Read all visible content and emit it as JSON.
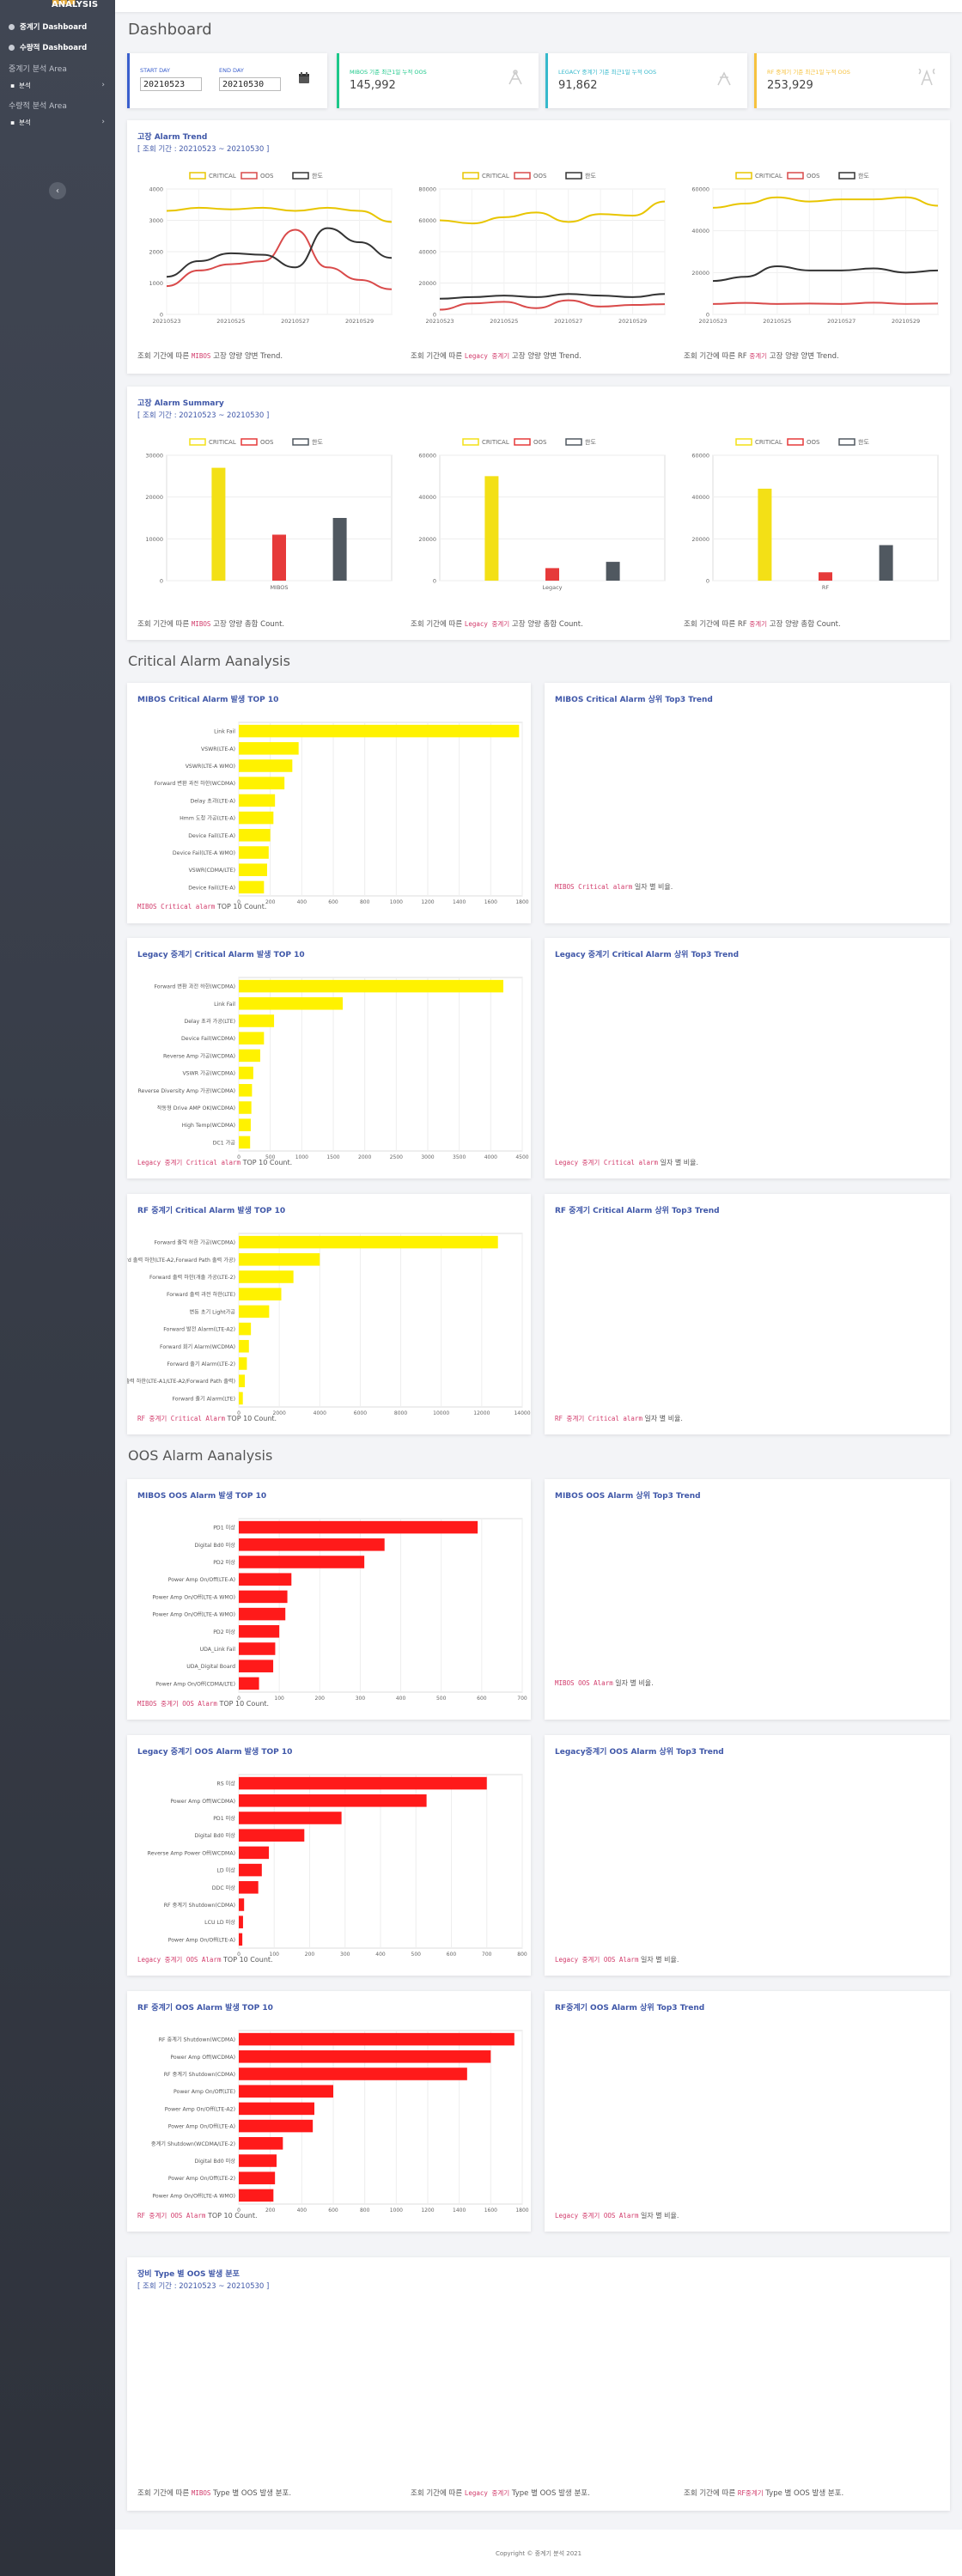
{
  "sidebar": {
    "brand_suffix": "ANALYSIS",
    "items": [
      {
        "label": "중계기 Dashboard"
      },
      {
        "label": "수량적 Dashboard"
      }
    ],
    "sections": [
      {
        "heading": "중계기 분석 Area",
        "sub": "분석"
      },
      {
        "heading": "수량적 분석 Area",
        "sub": "분석"
      }
    ],
    "toggle_icon": "chevron-left-icon"
  },
  "page": {
    "title": "Dashboard"
  },
  "date_range": {
    "start_label": "START DAY",
    "start_value": "20210523",
    "end_label": "END DAY",
    "end_value": "20210530",
    "icon": "calendar-icon"
  },
  "stats": [
    {
      "label": "MIBOS 기준 최근1일 누적 OOS",
      "value": "145,992",
      "color": "#1cc88a",
      "icon": "satellite-icon"
    },
    {
      "label": "LEGACY 중계기 기준 최근1일 누적 OOS",
      "value": "91,862",
      "color": "#36b9cc",
      "icon": "antenna-icon"
    },
    {
      "label": "RF 중계기 기준 최근1일 누적 OOS",
      "value": "253,929",
      "color": "#f6c23e",
      "icon": "tower-icon"
    }
  ],
  "trend": {
    "title": "고장 Alarm Trend",
    "subtitle": "[ 조회 기간 : 20210523 ~ 20210530 ]",
    "legend": [
      "CRITICAL",
      "OOS",
      "한도"
    ],
    "captions": [
      {
        "pre": "조회 기간에 따른 ",
        "code": "MIBOS",
        "post": " 고장 양량 양변 Trend."
      },
      {
        "pre": "조회 기간에 따른 ",
        "code": "Legacy 중계기",
        "post": " 고장 양량 양변 Trend."
      },
      {
        "pre": "조회 기간에 따른 RF ",
        "code": "중계기",
        "post": " 고장 양량 양변 Trend."
      }
    ]
  },
  "summary": {
    "title": "고장 Alarm Summary",
    "subtitle": "[ 조회 기간 : 20210523 ~ 20210530 ]",
    "legend": [
      "CRITICAL",
      "OOS",
      "한도"
    ],
    "captions": [
      {
        "pre": "조회 기간에 따른 ",
        "code": "MIBOS",
        "post": " 고장 양량 총합 Count."
      },
      {
        "pre": "조회 기간에 따른 ",
        "code": "Legacy 중계기",
        "post": " 고장 양량 총합 Count."
      },
      {
        "pre": "조회 기간에 따른 RF ",
        "code": "중계기",
        "post": " 고장 양량 총합 Count."
      }
    ]
  },
  "critical_section": {
    "title": "Critical Alarm Aanalysis"
  },
  "oos_section": {
    "title": "OOS Alarm Aanalysis"
  },
  "panels": {
    "mibos_crit": {
      "title": "MIBOS Critical Alarm 발생 TOP 10",
      "caption_code": "MIBOS Critical alarm",
      "caption_post": " TOP 10 Count."
    },
    "mibos_crit_top3": {
      "title": "MIBOS Critical Alarm 상위 Top3 Trend",
      "caption_code": "MIBOS Critical alarm",
      "caption_post": " 일자 별 비율."
    },
    "legacy_crit": {
      "title": "Legacy 중계기 Critical Alarm 발생 TOP 10",
      "caption_code": "Legacy 중계기 Critical alarm",
      "caption_post": " TOP 10 Count."
    },
    "legacy_crit_top3": {
      "title": "Legacy 중계기 Critical Alarm 상위 Top3 Trend",
      "caption_code": "Legacy 중계기 Critical alarm",
      "caption_post": " 일자 별 비율."
    },
    "rf_crit": {
      "title": "RF 중계기 Critical Alarm 발생 TOP 10",
      "caption_code": "RF 중계기 Critical Alarm",
      "caption_post": " TOP 10 Count."
    },
    "rf_crit_top3": {
      "title": "RF 중계기 Critical Alarm 상위 Top3 Trend",
      "caption_code": "RF 중계기 Critical alarm",
      "caption_post": " 일자 별 비율."
    },
    "mibos_oos": {
      "title": "MIBOS OOS Alarm 발생 TOP 10",
      "caption_code": "MIBOS 중계기 OOS Alarm",
      "caption_post": " TOP 10 Count."
    },
    "mibos_oos_top3": {
      "title": "MIBOS OOS Alarm 상위 Top3 Trend",
      "caption_code": "MIBOS OOS Alarm",
      "caption_post": " 일자 별 비율."
    },
    "legacy_oos": {
      "title": "Legacy 중계기 OOS Alarm 발생 TOP 10",
      "caption_code": "Legacy 중계기 OOS Alarm",
      "caption_post": " TOP 10 Count."
    },
    "legacy_oos_top3": {
      "title": "Legacy중계기 OOS Alarm 상위 Top3 Trend",
      "caption_code": "Legacy 중계기 OOS Alarm",
      "caption_post": " 일자 별 비율."
    },
    "rf_oos": {
      "title": "RF 중계기 OOS Alarm 발생 TOP 10",
      "caption_code": "RF 중계기 OOS Alarm",
      "caption_post": " TOP 10 Count."
    },
    "rf_oos_top3": {
      "title": "RF중계기 OOS Alarm 상위 Top3 Trend",
      "caption_code": "Legacy 중계기 OOS Alarm",
      "caption_post": " 일자 별 비율."
    }
  },
  "type_dist": {
    "title": "장비 Type 별 OOS 발생 분포",
    "subtitle": "[ 조회 기간 : 20210523 ~ 20210530 ]",
    "captions": [
      {
        "pre": "조회 기간에 따른 ",
        "code": "MIBOS",
        "post": " Type 별 OOS 발생 분포."
      },
      {
        "pre": "조회 기간에 따른 ",
        "code": "Legacy 중계기",
        "post": " Type 별 OOS 발생 분포."
      },
      {
        "pre": "조회 기간에 따른 ",
        "code": "RF중계기",
        "post": " Type 별 OOS 발생 분포."
      }
    ]
  },
  "footer": {
    "text": "Copyright © 중계기 분석 2021"
  },
  "colors": {
    "critical": "#f3e016",
    "oos": "#e63a3a",
    "limit": "#505860",
    "bar_red": "#ff1a1a",
    "bar_yellow": "#fff200",
    "title_blue": "#3f57a8"
  },
  "chart_data": [
    {
      "id": "trend_mibos",
      "type": "line",
      "x": [
        "20210523",
        "20210524",
        "20210525",
        "20210526",
        "20210527",
        "20210528",
        "20210529",
        "20210530"
      ],
      "ylim": [
        0,
        4000
      ],
      "yticks": [
        0,
        1000,
        2000,
        3000,
        4000
      ],
      "xticks": [
        "20210523",
        "20210525",
        "20210527",
        "20210529"
      ],
      "legend": [
        "CRITICAL",
        "OOS",
        "한도"
      ],
      "series": [
        {
          "name": "CRITICAL",
          "color": "#e8c500",
          "values": [
            3300,
            3400,
            3350,
            3400,
            3300,
            3400,
            3300,
            2950
          ]
        },
        {
          "name": "OOS",
          "color": "#d94a4a",
          "values": [
            900,
            1400,
            1600,
            1700,
            2700,
            1500,
            1100,
            800
          ]
        },
        {
          "name": "한도",
          "color": "#333333",
          "values": [
            1200,
            1700,
            1950,
            1900,
            1500,
            2750,
            2300,
            1800
          ]
        }
      ]
    },
    {
      "id": "trend_legacy",
      "type": "line",
      "x": [
        "20210523",
        "20210524",
        "20210525",
        "20210526",
        "20210527",
        "20210528",
        "20210529",
        "20210530"
      ],
      "ylim": [
        0,
        80000
      ],
      "yticks": [
        0,
        20000,
        40000,
        60000,
        80000
      ],
      "xticks": [
        "20210523",
        "20210525",
        "20210527",
        "20210529"
      ],
      "legend": [
        "CRITICAL",
        "OOS",
        "한도"
      ],
      "series": [
        {
          "name": "CRITICAL",
          "color": "#e8c500",
          "values": [
            60000,
            58000,
            62000,
            65000,
            59000,
            64000,
            63000,
            72000
          ]
        },
        {
          "name": "OOS",
          "color": "#d94a4a",
          "values": [
            3000,
            7000,
            8000,
            4000,
            9000,
            5000,
            6000,
            6500
          ]
        },
        {
          "name": "한도",
          "color": "#333333",
          "values": [
            10000,
            11000,
            12000,
            11000,
            13000,
            12000,
            11000,
            13000
          ]
        }
      ]
    },
    {
      "id": "trend_rf",
      "type": "line",
      "x": [
        "20210523",
        "20210524",
        "20210525",
        "20210526",
        "20210527",
        "20210528",
        "20210529",
        "20210530"
      ],
      "ylim": [
        0,
        60000
      ],
      "yticks": [
        0,
        20000,
        40000,
        60000
      ],
      "xticks": [
        "20210523",
        "20210525",
        "20210527",
        "20210529"
      ],
      "legend": [
        "CRITICAL",
        "OOS",
        "한도"
      ],
      "series": [
        {
          "name": "CRITICAL",
          "color": "#e8c500",
          "values": [
            51000,
            53000,
            56000,
            54000,
            55000,
            55000,
            56000,
            52000
          ]
        },
        {
          "name": "OOS",
          "color": "#d94a4a",
          "values": [
            5000,
            5500,
            5000,
            5200,
            5000,
            5600,
            5000,
            5200
          ]
        },
        {
          "name": "한도",
          "color": "#333333",
          "values": [
            16000,
            18000,
            23000,
            21000,
            21000,
            22000,
            20000,
            21000
          ]
        }
      ]
    },
    {
      "id": "sum_mibos",
      "type": "bar",
      "categories": [
        "MIBOS"
      ],
      "ylim": [
        0,
        30000
      ],
      "yticks": [
        0,
        10000,
        20000,
        30000
      ],
      "legend": [
        "CRITICAL",
        "OOS",
        "한도"
      ],
      "series": [
        {
          "name": "CRITICAL",
          "color": "#f3e016",
          "values": [
            27000
          ]
        },
        {
          "name": "OOS",
          "color": "#e63a3a",
          "values": [
            11000
          ]
        },
        {
          "name": "한도",
          "color": "#505860",
          "values": [
            15000
          ]
        }
      ]
    },
    {
      "id": "sum_legacy",
      "type": "bar",
      "categories": [
        "Legacy"
      ],
      "ylim": [
        0,
        60000
      ],
      "yticks": [
        0,
        20000,
        40000,
        60000
      ],
      "legend": [
        "CRITICAL",
        "OOS",
        "한도"
      ],
      "series": [
        {
          "name": "CRITICAL",
          "color": "#f3e016",
          "values": [
            50000
          ]
        },
        {
          "name": "OOS",
          "color": "#e63a3a",
          "values": [
            6000
          ]
        },
        {
          "name": "한도",
          "color": "#505860",
          "values": [
            9000
          ]
        }
      ]
    },
    {
      "id": "sum_rf",
      "type": "bar",
      "categories": [
        "RF"
      ],
      "ylim": [
        0,
        60000
      ],
      "yticks": [
        0,
        20000,
        40000,
        60000
      ],
      "legend": [
        "CRITICAL",
        "OOS",
        "한도"
      ],
      "series": [
        {
          "name": "CRITICAL",
          "color": "#f3e016",
          "values": [
            44000
          ]
        },
        {
          "name": "OOS",
          "color": "#e63a3a",
          "values": [
            4000
          ]
        },
        {
          "name": "한도",
          "color": "#505860",
          "values": [
            17000
          ]
        }
      ]
    },
    {
      "id": "hbar_mibos_crit",
      "type": "bar",
      "orientation": "horizontal",
      "color": "#fff200",
      "xlim": [
        0,
        1800
      ],
      "xticks": [
        0,
        200,
        400,
        600,
        800,
        1000,
        1200,
        1400,
        1600,
        1800
      ],
      "categories": [
        "Link Fail",
        "VSWR(LTE-A)",
        "VSWR(LTE-A WMO)",
        "Forward 변환 과전 하한(WCDMA)",
        "Delay 초과(LTE-A)",
        "Hmm 도청 가공(LTE-A)",
        "Device Fail(LTE-A)",
        "Device Fail(LTE-A WMO)",
        "VSWR(CDMA/LTE)",
        "Device Fail(LTE-A)"
      ],
      "values": [
        1780,
        380,
        340,
        290,
        230,
        220,
        200,
        190,
        180,
        160
      ]
    },
    {
      "id": "hbar_legacy_crit",
      "type": "bar",
      "orientation": "horizontal",
      "color": "#fff200",
      "xlim": [
        0,
        4500
      ],
      "xticks": [
        0,
        500,
        1000,
        1500,
        2000,
        2500,
        3000,
        3500,
        4000,
        4500
      ],
      "categories": [
        "Forward 변환 과전 하한(WCDMA)",
        "Link Fail",
        "Delay 초과 가공(LTE)",
        "Device Fail(WCDMA)",
        "Reverse Amp 가공(WCDMA)",
        "VSWR 가공(WCDMA)",
        "Reverse Diversity Amp 가공(WCDMA)",
        "작동형 Drive AMP OK(WCDMA)",
        "High Temp(WCDMA)",
        "DC1 가공"
      ],
      "values": [
        4200,
        1650,
        560,
        400,
        340,
        230,
        210,
        200,
        190,
        180
      ]
    },
    {
      "id": "hbar_rf_crit",
      "type": "bar",
      "orientation": "horizontal",
      "color": "#fff200",
      "xlim": [
        0,
        14000
      ],
      "xticks": [
        0,
        2000,
        4000,
        6000,
        8000,
        10000,
        12000,
        14000
      ],
      "categories": [
        "Forward 출력 하한 가공(WCDMA)",
        "Forward 출력 하한(LTE-A2,Forward Path 출력 가공)",
        "Forward 출력 하한(개출 가공(LTE-2)",
        "Forward 출력 과전 하한(LTE)",
        "변동 초기 Light가공",
        "Forward 발전 Alarm(LTE-A2)",
        "Forward 회기 Alarm(WCDMA)",
        "Forward 출기 Alarm(LTE-2)",
        "Forward 출력 하한(LTE-A1/LTE-A2/Forward Path 출력)",
        "Forward 출기 Alarm(LTE)"
      ],
      "values": [
        12800,
        4000,
        2700,
        2100,
        1500,
        600,
        500,
        400,
        300,
        200
      ]
    },
    {
      "id": "hbar_mibos_oos",
      "type": "bar",
      "orientation": "horizontal",
      "color": "#ff1a1a",
      "xlim": [
        0,
        700
      ],
      "xticks": [
        0,
        100,
        200,
        300,
        400,
        500,
        600,
        700
      ],
      "categories": [
        "PD1 미상",
        "Digital Bd0 미상",
        "PD2 미상",
        "Power Amp On/Off(LTE-A)",
        "Power Amp On/Off(LTE-A WMO)",
        "Power Amp On/Off(LTE-A WMO)",
        "PD2 미상",
        "UDA_Link Fail",
        "UDA_Digital Board",
        "Power Amp On/Off(CDMA/LTE)"
      ],
      "values": [
        590,
        360,
        310,
        130,
        120,
        115,
        100,
        90,
        85,
        50
      ]
    },
    {
      "id": "hbar_legacy_oos",
      "type": "bar",
      "orientation": "horizontal",
      "color": "#ff1a1a",
      "xlim": [
        0,
        800
      ],
      "xticks": [
        0,
        100,
        200,
        300,
        400,
        500,
        600,
        700,
        800
      ],
      "categories": [
        "RS 미상",
        "Power Amp Off(WCDMA)",
        "PD1 미상",
        "Digital Bd0 미상",
        "Reverse Amp Power Off(WCDMA)",
        "LD 미상",
        "DDC 미상",
        "RF 중계기 Shutdown(CDMA)",
        "LCU LD 미상",
        "Power Amp On/Off(LTE-A)"
      ],
      "values": [
        700,
        530,
        290,
        185,
        85,
        65,
        55,
        15,
        12,
        10
      ]
    },
    {
      "id": "hbar_rf_oos",
      "type": "bar",
      "orientation": "horizontal",
      "color": "#ff1a1a",
      "xlim": [
        0,
        1800
      ],
      "xticks": [
        0,
        200,
        400,
        600,
        800,
        1000,
        1200,
        1400,
        1600,
        1800
      ],
      "categories": [
        "RF 중계기 Shutdown(WCDMA)",
        "Power Amp Off(WCDMA)",
        "RF 중계기 Shutdown(CDMA)",
        "Power Amp On/Off(LTE)",
        "Power Amp On/Off(LTE-A2)",
        "Power Amp On/Off(LTE-A)",
        "중계기 Shutdown(WCDMA/LTE-2)",
        "Digital Bd0 미상",
        "Power Amp On/Off(LTE-2)",
        "Power Amp On/Off(LTE-A WMO)"
      ],
      "values": [
        1750,
        1600,
        1450,
        600,
        480,
        470,
        280,
        240,
        230,
        220
      ]
    }
  ]
}
